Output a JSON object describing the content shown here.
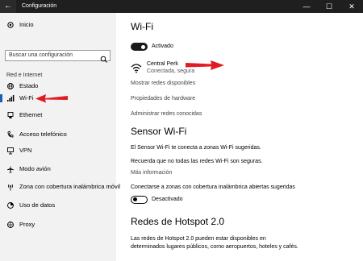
{
  "window": {
    "title": "Configuración",
    "back_icon": "back-arrow-icon",
    "controls": [
      "—",
      "☐",
      "✕"
    ]
  },
  "sidebar": {
    "home_label": "Inicio",
    "search_placeholder": "Buscar una configuración",
    "section_label": "Red e Internet",
    "items": [
      {
        "label": "Estado",
        "icon": "globe-icon"
      },
      {
        "label": "Wi-Fi",
        "icon": "wifi-icon"
      },
      {
        "label": "Ethernet",
        "icon": "ethernet-icon"
      },
      {
        "label": "Acceso telefónico",
        "icon": "dial-up-icon"
      },
      {
        "label": "VPN",
        "icon": "vpn-icon"
      },
      {
        "label": "Modo avión",
        "icon": "airplane-icon"
      },
      {
        "label": "Zona con cobertura inalámbrica móvil",
        "icon": "hotspot-icon"
      },
      {
        "label": "Uso de datos",
        "icon": "data-usage-icon"
      },
      {
        "label": "Proxy",
        "icon": "proxy-icon"
      }
    ],
    "selected_index": 1
  },
  "main": {
    "title": "Wi-Fi",
    "wifi_toggle": {
      "state": "on",
      "label": "Activado"
    },
    "network": {
      "name": "Central Perk",
      "status": "Conectada, segura"
    },
    "links": [
      "Mostrar redes disponibles",
      "Propiedades de hardware",
      "Administrar redes conocidas"
    ],
    "sensor": {
      "title": "Sensor Wi-Fi",
      "desc": "El Sensor Wi-Fi te conecta a zonas Wi-Fi sugeridas.",
      "note": "Recuerda que no todas las redes Wi-Fi son seguras.",
      "more_link": "Más información",
      "option_label": "Conectarse a zonas con cobertura inalámbrica abiertas sugeridas",
      "option_toggle": {
        "state": "off",
        "label": "Desactivado"
      }
    },
    "hotspot": {
      "title": "Redes de Hotspot 2.0",
      "desc_line1": "Las redes de Hotspot 2.0 pueden estar disponibles en",
      "desc_line2": "determinados lugares públicos, como aeropuertos, hoteles y cafés."
    }
  },
  "colors": {
    "accent": "#1a5fb4",
    "annotation_arrow": "#e01b24",
    "titlebar": "#1f1f1f",
    "sidebar_bg": "#f2f2f2"
  }
}
